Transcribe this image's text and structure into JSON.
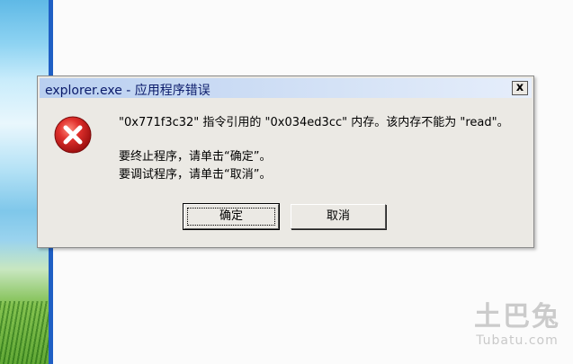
{
  "dialog": {
    "title": "explorer.exe - 应用程序错误",
    "close_glyph": "x",
    "message_line1": "\"0x771f3c32\" 指令引用的 \"0x034ed3cc\" 内存。该内存不能为 \"read\"。",
    "message_line2": "要终止程序，请单击“确定”。",
    "message_line3": "要调试程序，请单击“取消”。",
    "icon": "error-icon",
    "ok_label": "确定",
    "cancel_label": "取消"
  },
  "watermark": {
    "text_cn": "土巴兔",
    "text_en": "Tubatu.com"
  },
  "colors": {
    "titlebar": "#c8daf3",
    "dialog_bg": "#ebe9e4",
    "error_red": "#d8232a",
    "window_edge": "#1f5fc4"
  }
}
